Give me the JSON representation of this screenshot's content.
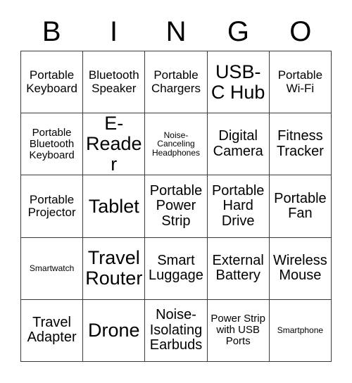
{
  "card": {
    "header_letters": [
      "B",
      "I",
      "N",
      "G",
      "O"
    ],
    "columns": 5,
    "rows": 5,
    "grid_line_color": "#3a3a3a",
    "background_color": "#ffffff",
    "text_color": "#000000",
    "cells": [
      [
        {
          "label": "Portable Keyboard",
          "size": "md"
        },
        {
          "label": "Bluetooth Speaker",
          "size": "md"
        },
        {
          "label": "Portable Chargers",
          "size": "md"
        },
        {
          "label": "USB-C Hub",
          "size": "xxl"
        },
        {
          "label": "Portable Wi-Fi",
          "size": "md"
        }
      ],
      [
        {
          "label": "Portable Bluetooth Keyboard",
          "size": "sm"
        },
        {
          "label": "E-Reader",
          "size": "xxl"
        },
        {
          "label": "Noise-Canceling Headphones",
          "size": "xs"
        },
        {
          "label": "Digital Camera",
          "size": "lg"
        },
        {
          "label": "Fitness Tracker",
          "size": "lg"
        }
      ],
      [
        {
          "label": "Portable Projector",
          "size": "md"
        },
        {
          "label": "Tablet",
          "size": "xxl"
        },
        {
          "label": "Portable Power Strip",
          "size": "lg"
        },
        {
          "label": "Portable Hard Drive",
          "size": "lg"
        },
        {
          "label": "Portable Fan",
          "size": "lg"
        }
      ],
      [
        {
          "label": "Smartwatch",
          "size": "xs"
        },
        {
          "label": "Travel Router",
          "size": "xxl"
        },
        {
          "label": "Smart Luggage",
          "size": "lg"
        },
        {
          "label": "External Battery",
          "size": "lg"
        },
        {
          "label": "Wireless Mouse",
          "size": "lg"
        }
      ],
      [
        {
          "label": "Travel Adapter",
          "size": "lg"
        },
        {
          "label": "Drone",
          "size": "xxl"
        },
        {
          "label": "Noise-Isolating Earbuds",
          "size": "lg"
        },
        {
          "label": "Power Strip with USB Ports",
          "size": "sm"
        },
        {
          "label": "Smartphone",
          "size": "xs"
        }
      ]
    ]
  }
}
